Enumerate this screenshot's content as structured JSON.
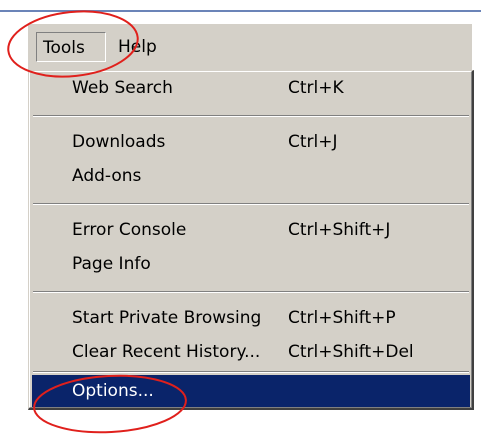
{
  "menubar": {
    "tools_label": "Tools",
    "help_label": "Help"
  },
  "menu": {
    "items": [
      {
        "label": "Web Search",
        "shortcut": "Ctrl+K"
      },
      {
        "label": "Downloads",
        "shortcut": "Ctrl+J"
      },
      {
        "label": "Add-ons",
        "shortcut": ""
      },
      {
        "label": "Error Console",
        "shortcut": "Ctrl+Shift+J"
      },
      {
        "label": "Page Info",
        "shortcut": ""
      },
      {
        "label": "Start Private Browsing",
        "shortcut": "Ctrl+Shift+P"
      },
      {
        "label": "Clear Recent History...",
        "shortcut": "Ctrl+Shift+Del"
      },
      {
        "label": "Options...",
        "shortcut": ""
      }
    ]
  },
  "colors": {
    "menu_bg": "#d4d0c8",
    "highlight_bg": "#0a246a",
    "annotation": "#e0201c"
  }
}
